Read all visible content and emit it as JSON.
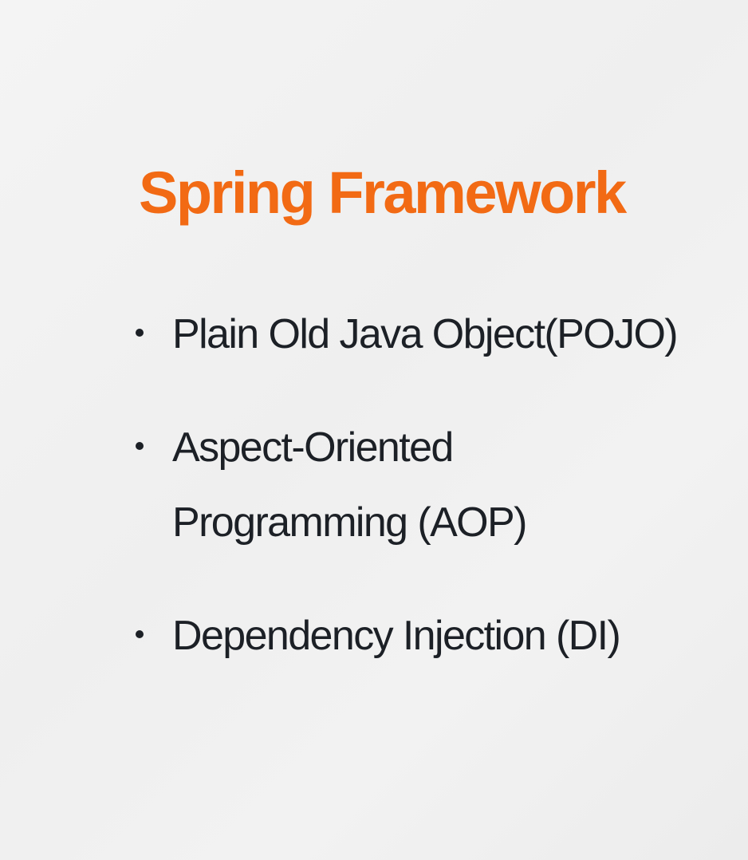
{
  "slide": {
    "title": "Spring Framework",
    "bullets": [
      {
        "text": "Plain Old Java Object(POJO)"
      },
      {
        "text": "Aspect-Oriented Programming (AOP)"
      },
      {
        "text": "Dependency Injection (DI)"
      }
    ]
  },
  "colors": {
    "title": "#f26a14",
    "text": "#1c2026",
    "bullet": "#1c2026"
  }
}
